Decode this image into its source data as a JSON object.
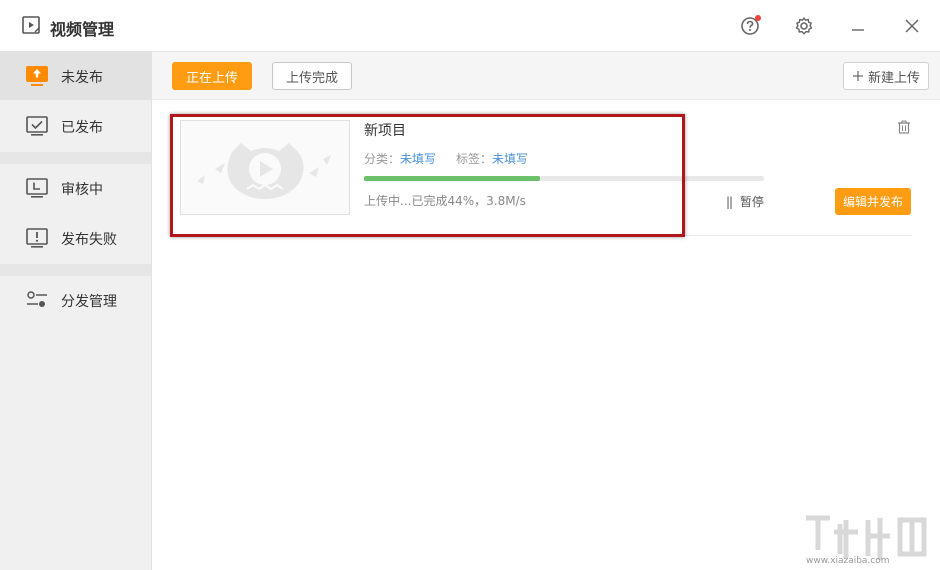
{
  "window": {
    "title": "视频管理",
    "icons": {
      "app": "video-app-icon",
      "help": "help-icon",
      "settings": "gear-icon",
      "minimize": "minimize-icon",
      "close": "close-icon"
    }
  },
  "sidebar": {
    "items": [
      {
        "label": "未发布",
        "icon": "upload-icon",
        "active": true
      },
      {
        "label": "已发布",
        "icon": "check-box-icon"
      },
      {
        "label": "审核中",
        "icon": "clock-monitor-icon"
      },
      {
        "label": "发布失败",
        "icon": "alert-box-icon"
      },
      {
        "label": "分发管理",
        "icon": "sliders-icon"
      }
    ]
  },
  "toolbar": {
    "uploading_label": "正在上传",
    "done_label": "上传完成",
    "new_upload_label": "新建上传"
  },
  "upload_item": {
    "title": "新项目",
    "category_label": "分类：",
    "category_value": "未填写",
    "tag_label": "标签：",
    "tag_value": "未填写",
    "progress": 0.44,
    "status_text": "上传中...已完成44%，3.8M/s",
    "pause_label": "暂停",
    "edit_publish_label": "编辑并发布"
  },
  "watermark": {
    "site": "www.xiazaiba.com"
  },
  "colors": {
    "accent": "#ff9c12",
    "progress": "#6dc06a",
    "link": "#4a8fd8",
    "highlight": "#b2151b"
  }
}
